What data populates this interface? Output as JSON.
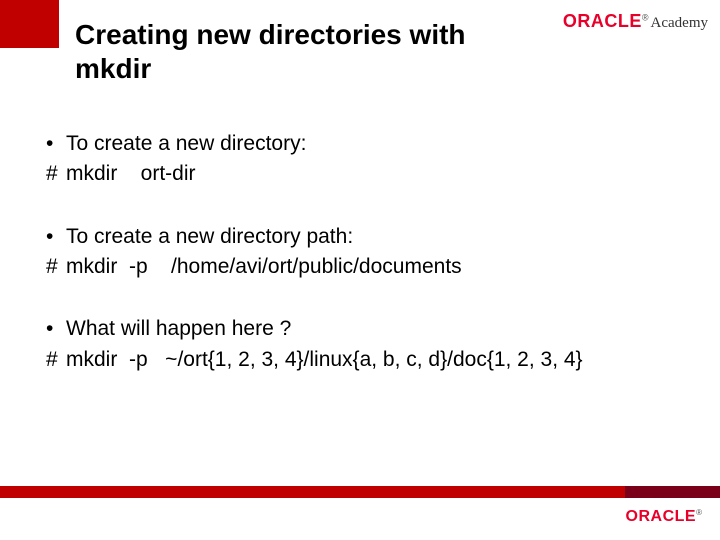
{
  "logo": {
    "brand": "ORACLE",
    "reg": "®",
    "sub": "Academy"
  },
  "title": "Creating new directories with mkdir",
  "bullets": [
    {
      "text": "To create a new directory:",
      "cmd": "mkdir    ort-dir"
    },
    {
      "text": "To create a new directory path:",
      "cmd": "mkdir  -p    /home/avi/ort/public/documents"
    },
    {
      "text": "What will happen here ?",
      "cmd": "mkdir  -p   ~/ort{1, 2, 3, 4}/linux{a, b, c, d}/doc{1, 2, 3, 4}"
    }
  ],
  "marks": {
    "bullet": "•",
    "hash": "#"
  }
}
